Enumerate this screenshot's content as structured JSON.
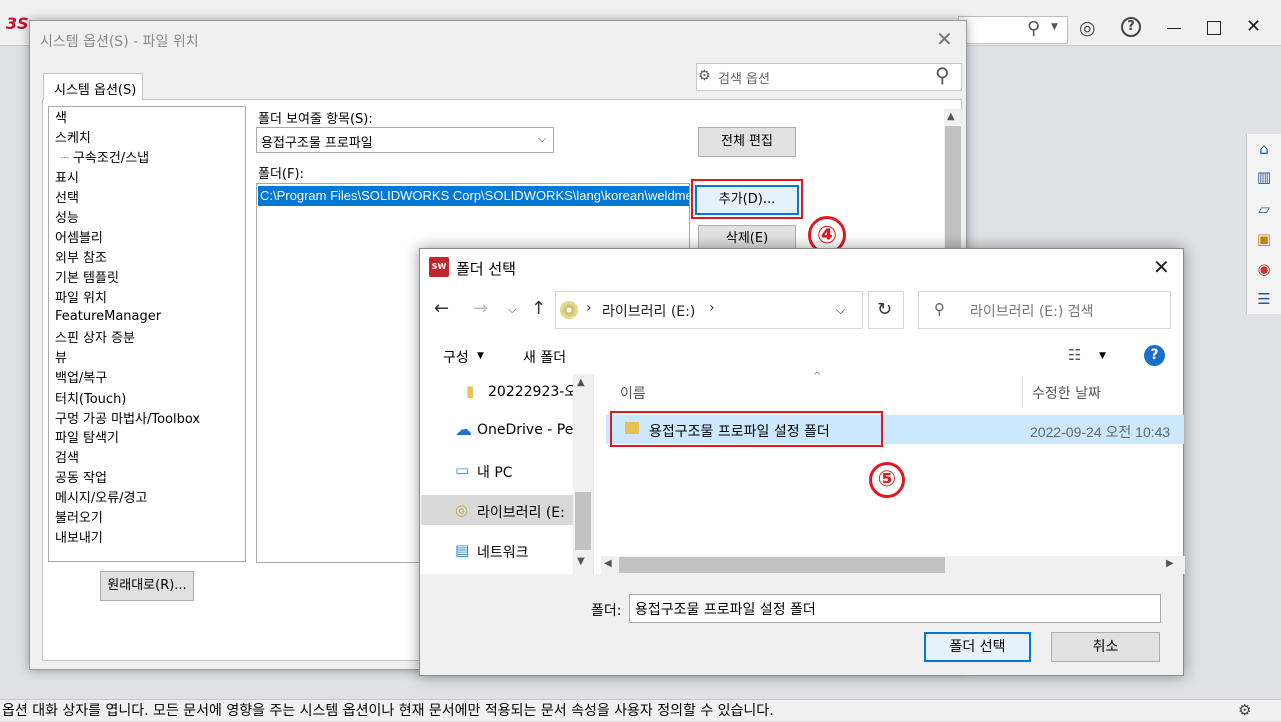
{
  "app": {
    "logo": "3S",
    "search_icon": "search-icon",
    "status_text": "옵션 대화 상자를 엽니다. 모든 문서에 영향을 주는 시스템 옵션이나 현재 문서에만 적용되는 문서 속성을 사용자 정의할 수 있습니다."
  },
  "options_dialog": {
    "title": "시스템 옵션(S) - 파일 위치",
    "tab": "시스템 옵션(S)",
    "search_placeholder": "검색 옵션",
    "tree_items": [
      "색",
      "스케치",
      "구속조건/스냅",
      "표시",
      "선택",
      "성능",
      "어셈블리",
      "외부 참조",
      "기본 템플릿",
      "파일 위치",
      "FeatureManager",
      "스핀 상자 증분",
      "뷰",
      "백업/복구",
      "터치(Touch)",
      "구멍 가공 마법사/Toolbox",
      "파일 탐색기",
      "검색",
      "공동 작업",
      "메시지/오류/경고",
      "불러오기",
      "내보내기"
    ],
    "reset_button": "원래대로(R)...",
    "show_folders_label": "폴더 보여줄 항목(S):",
    "show_folders_value": "용접구조물 프로파일",
    "folders_label": "폴더(F):",
    "folder_path": "C:\\Program Files\\SOLIDWORKS Corp\\SOLIDWORKS\\lang\\korean\\weldment profiles",
    "edit_all_button": "전체 편집",
    "add_button": "추가(D)...",
    "delete_button": "삭제(E)",
    "step_marker": "④"
  },
  "folder_dialog": {
    "title": "폴더 선택",
    "icon_text": "SW 2021",
    "address_location": "라이브러리 (E:)",
    "search_placeholder": "라이브러리 (E:) 검색",
    "organize_label": "구성",
    "new_folder_label": "새 폴더",
    "nav_items": [
      {
        "label": "20222923-오...",
        "icon": "folder-icon"
      },
      {
        "label": "OneDrive - Pe",
        "icon": "onedrive-icon"
      },
      {
        "label": "내 PC",
        "icon": "pc-icon"
      },
      {
        "label": "라이브러리 (E:",
        "icon": "disc-icon"
      },
      {
        "label": "네트워크",
        "icon": "network-icon"
      }
    ],
    "column_name": "이름",
    "column_date": "수정한 날짜",
    "row_name": "용접구조물 프로파일 설정 폴더",
    "row_date": "2022-09-24 오전 10:43",
    "folder_label": "폴더:",
    "folder_value": "용접구조물 프로파일 설정 폴더",
    "select_button": "폴더 선택",
    "cancel_button": "취소",
    "step_marker": "⑤"
  },
  "colors": {
    "accent": "#0078d7",
    "highlight_red": "#e0191e",
    "selection_bg": "#cce8ff"
  }
}
